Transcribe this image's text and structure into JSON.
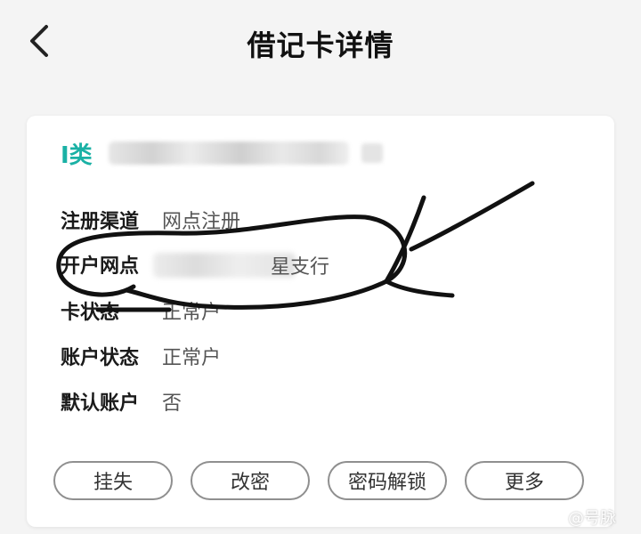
{
  "header": {
    "title": "借记卡详情"
  },
  "card": {
    "type_label": "I类",
    "info": [
      {
        "label": "注册渠道",
        "value": "网点注册"
      },
      {
        "label": "开户网点",
        "value": "星支行"
      },
      {
        "label": "卡状态",
        "value": "正常户"
      },
      {
        "label": "账户状态",
        "value": "正常户"
      },
      {
        "label": "默认账户",
        "value": "否"
      }
    ],
    "actions": [
      {
        "label": "挂失"
      },
      {
        "label": "改密"
      },
      {
        "label": "密码解锁"
      },
      {
        "label": "更多"
      }
    ]
  },
  "watermark": {
    "text": "@号脉"
  },
  "colors": {
    "accent": "#1ab1a5",
    "background": "#f4f4f4",
    "card": "#ffffff",
    "scribble": "#111111"
  }
}
